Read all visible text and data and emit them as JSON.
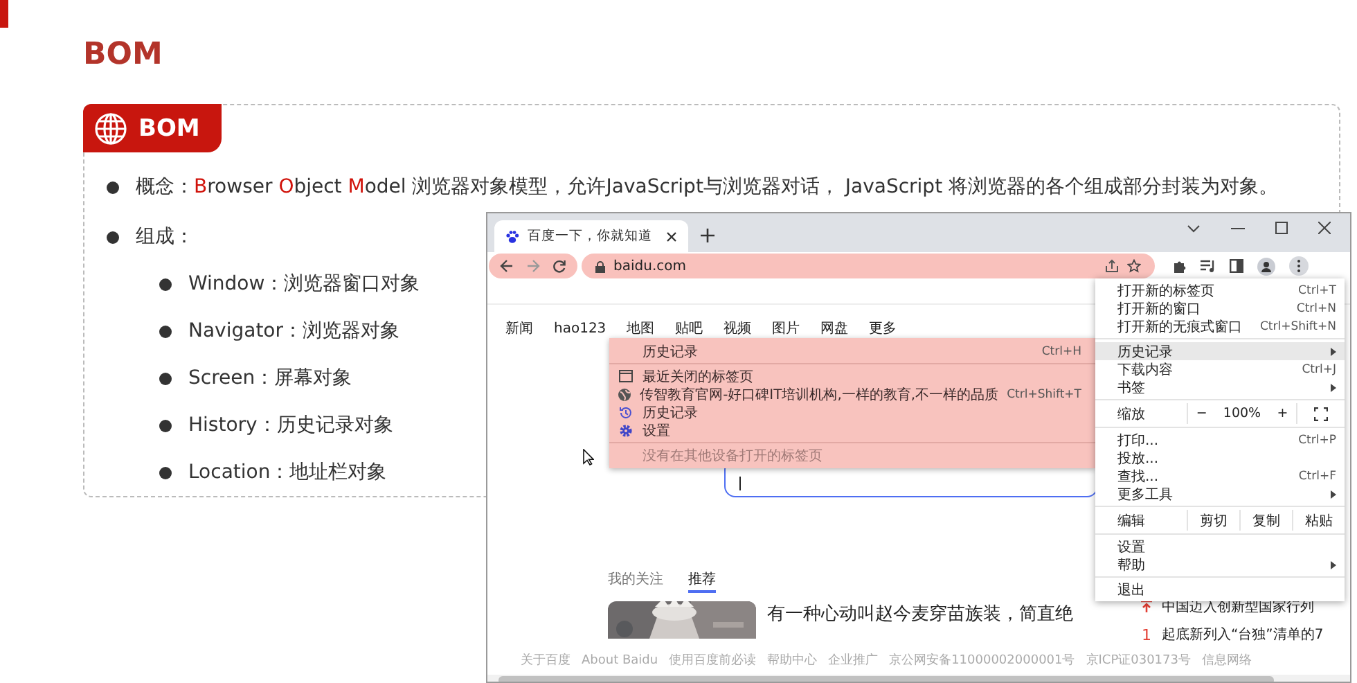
{
  "slide": {
    "title": "BOM",
    "badge": "BOM",
    "concept": [
      {
        "text": "概念：",
        "accent": false
      },
      {
        "text": "B",
        "accent": true
      },
      {
        "text": "rowser ",
        "accent": false
      },
      {
        "text": "O",
        "accent": true
      },
      {
        "text": "bject ",
        "accent": false
      },
      {
        "text": "M",
        "accent": true
      },
      {
        "text": "odel 浏览器对象模型，允许JavaScript与浏览器对话， JavaScript 将浏览器的各个组成部分封装为对象。",
        "accent": false
      }
    ],
    "composition": "组成：",
    "items": [
      "Window：浏览器窗口对象",
      "Navigator：浏览器对象",
      "Screen：屏幕对象",
      "History：历史记录对象",
      "Location：地址栏对象"
    ]
  },
  "browser": {
    "tab_title": "百度一下，你就知道",
    "address": "baidu.com",
    "nav": [
      "新闻",
      "hao123",
      "地图",
      "贴吧",
      "视频",
      "图片",
      "网盘",
      "更多"
    ],
    "submenu": [
      [
        {
          "kind": "header",
          "label": "历史记录",
          "shortcut": "Ctrl+H"
        }
      ],
      [
        {
          "kind": "window",
          "label": "最近关闭的标签页"
        },
        {
          "kind": "globe",
          "label": "传智教育官网-好口碑IT培训机构,一样的教育,不一样的品质",
          "shortcut": "Ctrl+Shift+T"
        },
        {
          "kind": "history",
          "label": "历史记录"
        },
        {
          "kind": "gear",
          "label": "设置"
        }
      ],
      [
        {
          "kind": "note",
          "label": "没有在其他设备打开的标签页"
        }
      ]
    ],
    "menu": [
      [
        {
          "kind": "item",
          "label": "打开新的标签页",
          "shortcut": "Ctrl+T",
          "submenu": false,
          "selected": false
        },
        {
          "kind": "item",
          "label": "打开新的窗口",
          "shortcut": "Ctrl+N",
          "submenu": false,
          "selected": false
        },
        {
          "kind": "item",
          "label": "打开新的无痕式窗口",
          "shortcut": "Ctrl+Shift+N",
          "submenu": false,
          "selected": false
        }
      ],
      [
        {
          "kind": "item",
          "label": "历史记录",
          "submenu": true,
          "selected": true
        },
        {
          "kind": "item",
          "label": "下载内容",
          "shortcut": "Ctrl+J",
          "submenu": false,
          "selected": false
        },
        {
          "kind": "item",
          "label": "书签",
          "submenu": true,
          "selected": false
        }
      ],
      [
        {
          "kind": "zoom",
          "label": "缩放",
          "minus": "−",
          "value": "100%",
          "plus": "+"
        }
      ],
      [
        {
          "kind": "item",
          "label": "打印...",
          "shortcut": "Ctrl+P",
          "submenu": false,
          "selected": false
        },
        {
          "kind": "item",
          "label": "投放...",
          "submenu": false,
          "selected": false
        },
        {
          "kind": "item",
          "label": "查找...",
          "shortcut": "Ctrl+F",
          "submenu": false,
          "selected": false
        },
        {
          "kind": "item",
          "label": "更多工具",
          "submenu": true,
          "selected": false
        }
      ],
      [
        {
          "kind": "edit",
          "label": "编辑",
          "actions": [
            "剪切",
            "复制",
            "粘贴"
          ]
        }
      ],
      [
        {
          "kind": "item",
          "label": "设置",
          "submenu": false,
          "selected": false
        },
        {
          "kind": "item",
          "label": "帮助",
          "submenu": true,
          "selected": false
        }
      ],
      [
        {
          "kind": "item",
          "label": "退出",
          "submenu": false,
          "selected": false
        }
      ]
    ],
    "feed_tabs": [
      {
        "label": "我的关注",
        "selected": false
      },
      {
        "label": "推荐",
        "selected": true
      }
    ],
    "headline": "有一种心动叫赵今麦穿苗族装，简直绝",
    "hot": [
      {
        "kind": "pinned",
        "text": "中国迈入创新型国家行列"
      },
      {
        "kind": "ranked",
        "rank": "1",
        "text": "起底新列入“台独”清单的7"
      }
    ],
    "footer": [
      "关于百度",
      "About Baidu",
      "使用百度前必读",
      "帮助中心",
      "企业推广",
      "京公网安备11000002000001号",
      "京ICP证030173号",
      "信息网络"
    ]
  }
}
